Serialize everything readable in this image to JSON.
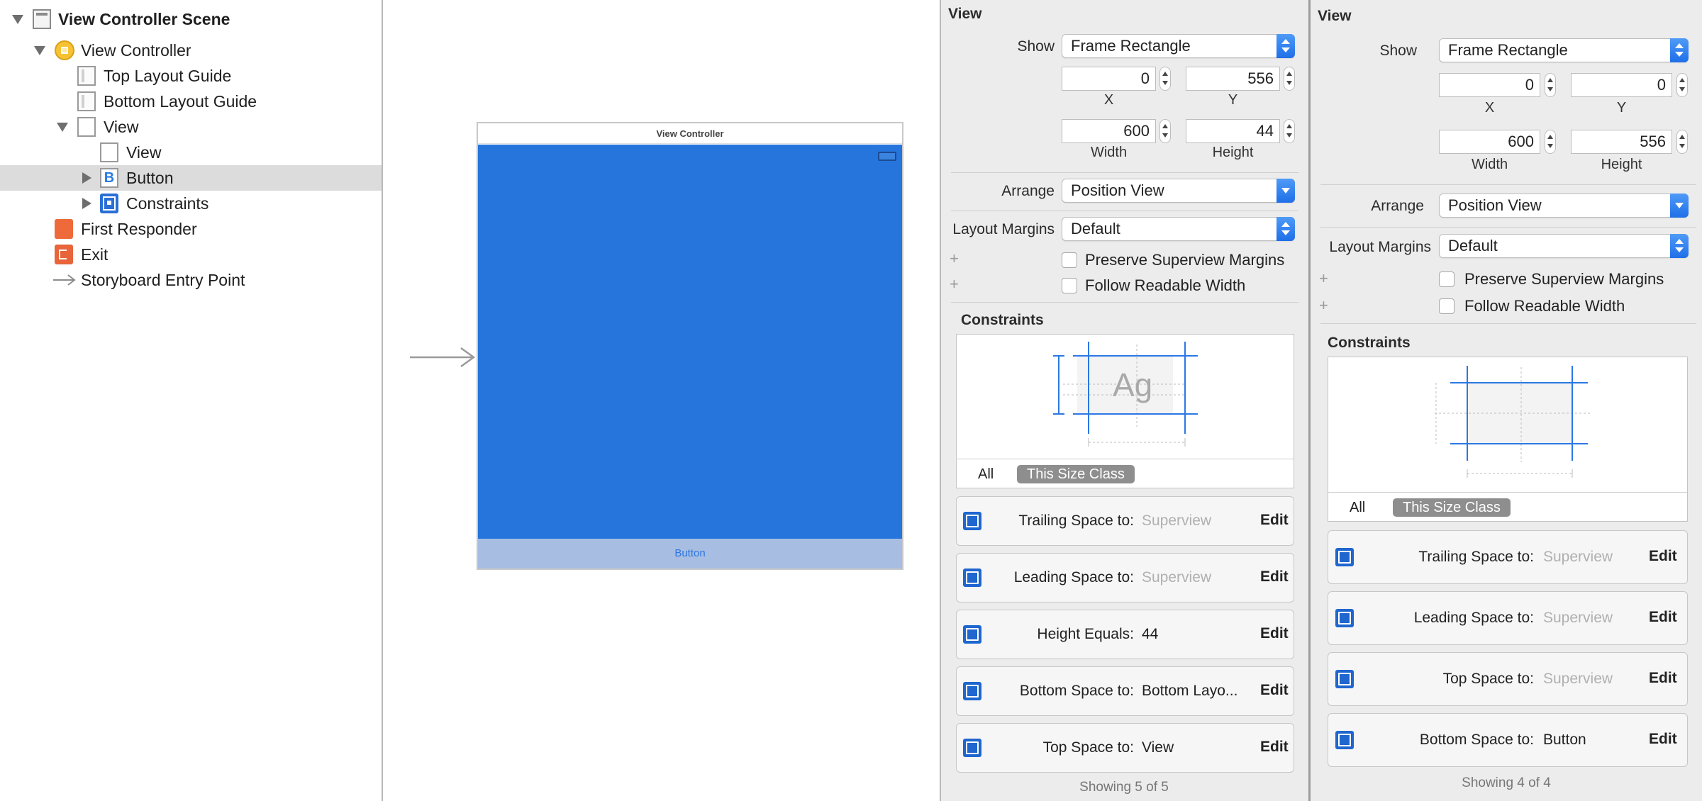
{
  "outline": {
    "items": [
      {
        "label": "View Controller Scene",
        "icon": "scene-icon",
        "bold": true
      },
      {
        "label": "View Controller",
        "icon": "view-controller-icon"
      },
      {
        "label": "Top Layout Guide",
        "icon": "layout-guide-icon"
      },
      {
        "label": "Bottom Layout Guide",
        "icon": "layout-guide-icon"
      },
      {
        "label": "View",
        "icon": "view-icon"
      },
      {
        "label": "View",
        "icon": "view-icon"
      },
      {
        "label": "Button",
        "icon": "button-icon",
        "icon_glyph": "B",
        "selected": true
      },
      {
        "label": "Constraints",
        "icon": "constraints-icon"
      },
      {
        "label": "First Responder",
        "icon": "first-responder-icon"
      },
      {
        "label": "Exit",
        "icon": "exit-icon"
      },
      {
        "label": "Storyboard Entry Point",
        "icon": "entry-arrow-icon"
      }
    ]
  },
  "canvas": {
    "scene_title": "View Controller",
    "button_label": "Button",
    "view_color": "#2675dc",
    "button_bg": "#a8bde2"
  },
  "inspector_a": {
    "title": "View",
    "show_label": "Show",
    "show_value": "Frame Rectangle",
    "x_value": "0",
    "x_caption": "X",
    "y_value": "556",
    "y_caption": "Y",
    "width_value": "600",
    "width_caption": "Width",
    "height_value": "44",
    "height_caption": "Height",
    "arrange_label": "Arrange",
    "arrange_value": "Position View",
    "margins_label": "Layout Margins",
    "margins_value": "Default",
    "plus": "+",
    "preserve_label": "Preserve Superview Margins",
    "readable_label": "Follow Readable Width",
    "constraints_title": "Constraints",
    "ag_text": "Ag",
    "tab_all": "All",
    "tab_size_class": "This Size Class",
    "constraints": [
      {
        "label": "Trailing Space to:",
        "value": "Superview",
        "dim": true,
        "edit": "Edit",
        "icon": "trailing-space-icon"
      },
      {
        "label": "Leading Space to:",
        "value": "Superview",
        "dim": true,
        "edit": "Edit",
        "icon": "leading-space-icon"
      },
      {
        "label": "Height Equals:",
        "value": "44",
        "dim": false,
        "edit": "Edit",
        "icon": "height-icon"
      },
      {
        "label": "Bottom Space to:",
        "value": "Bottom Layo...",
        "dim": false,
        "edit": "Edit",
        "icon": "bottom-space-icon"
      },
      {
        "label": "Top Space to:",
        "value": "View",
        "dim": false,
        "edit": "Edit",
        "icon": "top-space-icon"
      }
    ],
    "footer": "Showing 5 of 5"
  },
  "inspector_b": {
    "title": "View",
    "show_label": "Show",
    "show_value": "Frame Rectangle",
    "x_value": "0",
    "x_caption": "X",
    "y_value": "0",
    "y_caption": "Y",
    "width_value": "600",
    "width_caption": "Width",
    "height_value": "556",
    "height_caption": "Height",
    "arrange_label": "Arrange",
    "arrange_value": "Position View",
    "margins_label": "Layout Margins",
    "margins_value": "Default",
    "plus": "+",
    "preserve_label": "Preserve Superview Margins",
    "readable_label": "Follow Readable Width",
    "constraints_title": "Constraints",
    "tab_all": "All",
    "tab_size_class": "This Size Class",
    "constraints": [
      {
        "label": "Trailing Space to:",
        "value": "Superview",
        "dim": true,
        "edit": "Edit",
        "icon": "trailing-space-icon"
      },
      {
        "label": "Leading Space to:",
        "value": "Superview",
        "dim": true,
        "edit": "Edit",
        "icon": "leading-space-icon"
      },
      {
        "label": "Top Space to:",
        "value": "Superview",
        "dim": true,
        "edit": "Edit",
        "icon": "top-space-icon"
      },
      {
        "label": "Bottom Space to:",
        "value": "Button",
        "dim": false,
        "edit": "Edit",
        "icon": "bottom-space-icon"
      }
    ],
    "footer": "Showing 4 of 4"
  }
}
